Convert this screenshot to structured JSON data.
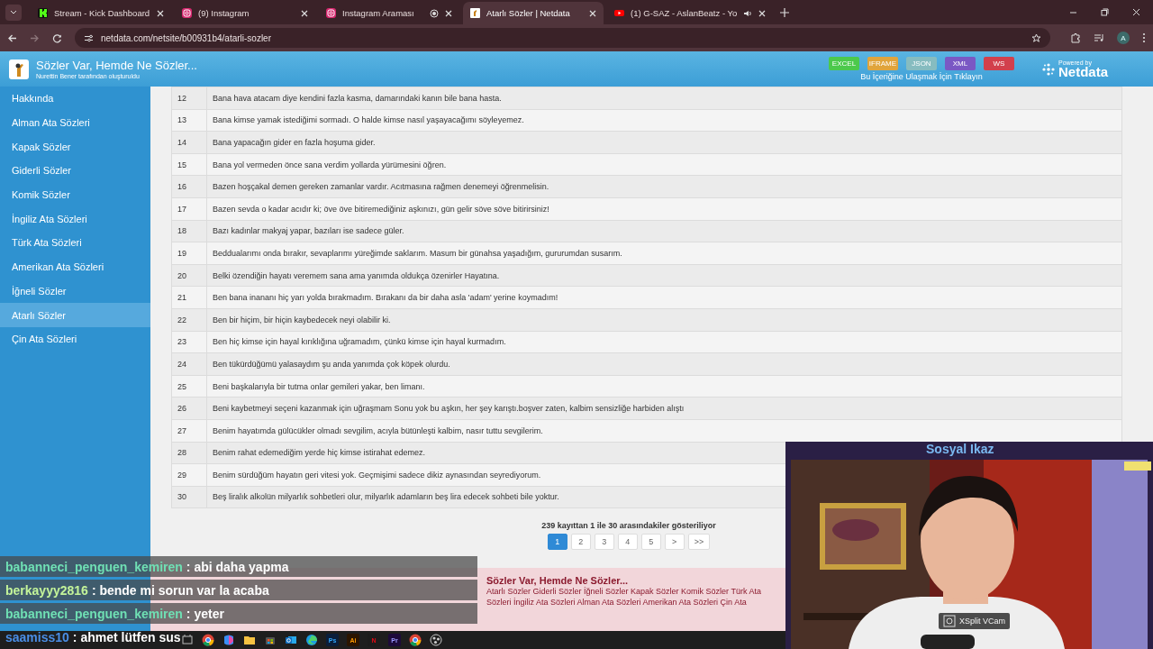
{
  "browser": {
    "tabs": [
      {
        "title": "Stream - Kick Dashboard",
        "kind": "kick",
        "selected": false,
        "recording": false,
        "audio": false
      },
      {
        "title": "(9) Instagram",
        "kind": "instagram",
        "selected": false,
        "recording": false,
        "audio": false
      },
      {
        "title": "Instagram Araması",
        "kind": "instagram",
        "selected": false,
        "recording": true,
        "audio": false
      },
      {
        "title": "Atarlı Sözler | Netdata",
        "kind": "site",
        "selected": true,
        "recording": false,
        "audio": false
      },
      {
        "title": "(1) G-SAZ - AslanBeatz - Yo",
        "kind": "youtube",
        "selected": false,
        "recording": false,
        "audio": true
      }
    ],
    "url": "netdata.com/netsite/b00931b4/atarli-sozler",
    "profile": "A"
  },
  "site_header": {
    "title": "Sözler Var, Hemde Ne Sözler...",
    "subtitle": "Nurettin Bener tarafından oluşturuldu",
    "exports": [
      {
        "label": "EXCEL",
        "color": "#4cc94c"
      },
      {
        "label": "IFRAME",
        "color": "#e0a43c"
      },
      {
        "label": "JSON",
        "color": "#86bcc0"
      },
      {
        "label": "XML",
        "color": "#7a58c4"
      },
      {
        "label": "WS",
        "color": "#d2404c"
      }
    ],
    "access_link": "Bu İçeriğine Ulaşmak İçin Tıklayın",
    "powered_by": "Powered by",
    "brand": "Netdata"
  },
  "sidebar": {
    "items": [
      {
        "label": "Hakkında",
        "selected": false
      },
      {
        "label": "Alman Ata Sözleri",
        "selected": false
      },
      {
        "label": "Kapak Sözler",
        "selected": false
      },
      {
        "label": "Giderli Sözler",
        "selected": false
      },
      {
        "label": "Komik Sözler",
        "selected": false
      },
      {
        "label": "İngiliz Ata Sözleri",
        "selected": false
      },
      {
        "label": "Türk Ata Sözleri",
        "selected": false
      },
      {
        "label": "Amerikan Ata Sözleri",
        "selected": false
      },
      {
        "label": "İğneli Sözler",
        "selected": false
      },
      {
        "label": "Atarlı Sözler",
        "selected": true
      },
      {
        "label": "Çin Ata Sözleri",
        "selected": false
      }
    ]
  },
  "table": {
    "rows": [
      {
        "number": "12",
        "text": "Bana hava atacam diye kendini fazla kasma, damarındaki kanın bile bana hasta."
      },
      {
        "number": "13",
        "text": "Bana kimse yamak istediğimi sormadı. O halde kimse nasıl yaşayacağımı söyleyemez."
      },
      {
        "number": "14",
        "text": "Bana yapacağın gider en fazla hoşuma gider."
      },
      {
        "number": "15",
        "text": "Bana yol vermeden önce sana verdim yollarda yürümesini öğren."
      },
      {
        "number": "16",
        "text": "Bazen hoşçakal demen gereken zamanlar vardır. Acıtmasına rağmen denemeyi öğrenmelisin."
      },
      {
        "number": "17",
        "text": "Bazen sevda o kadar acıdır ki; öve öve bitiremediğiniz aşkınızı, gün gelir söve söve bitirirsiniz!"
      },
      {
        "number": "18",
        "text": "Bazı kadınlar makyaj yapar, bazıları ise sadece güler."
      },
      {
        "number": "19",
        "text": "Beddualarımı onda bırakır, sevaplarımı yüreğimde saklarım. Masum bir günahsa yaşadığım, gururumdan susarım."
      },
      {
        "number": "20",
        "text": "Belki özendiğin hayatı veremem sana ama yanımda oldukça özenirler Hayatına."
      },
      {
        "number": "21",
        "text": "Ben bana inananı hiç yarı yolda bırakmadım. Bırakanı da bir daha asla 'adam' yerine koymadım!"
      },
      {
        "number": "22",
        "text": "Ben bir hiçim, bir hiçin kaybedecek neyi olabilir ki."
      },
      {
        "number": "23",
        "text": "Ben hiç kimse için hayal kırıklığına uğramadım, çünkü kimse için hayal kurmadım."
      },
      {
        "number": "24",
        "text": "Ben tükürdüğümü yalasaydım şu anda yanımda çok köpek olurdu."
      },
      {
        "number": "25",
        "text": "Beni başkalarıyla bir tutma onlar gemileri yakar, ben limanı."
      },
      {
        "number": "26",
        "text": "Beni kaybetmeyi seçeni kazanmak için uğraşmam Sonu yok bu aşkın, her şey karıştı.boşver zaten, kalbim sensizliğe harbiden alıştı"
      },
      {
        "number": "27",
        "text": "Benim hayatımda gülücükler olmadı sevgilim, acıyla bütünleşti kalbim, nasır tuttu sevgilerim."
      },
      {
        "number": "28",
        "text": "Benim rahat edemediğim yerde hiç kimse istirahat edemez."
      },
      {
        "number": "29",
        "text": "Benim sürdüğüm hayatın geri vitesi yok. Geçmişimi sadece dikiz aynasından seyrediyorum."
      },
      {
        "number": "30",
        "text": "Beş liralık alkolün milyarlık sohbetleri olur, milyarlık adamların beş lira edecek sohbeti bile yoktur."
      }
    ]
  },
  "pagination": {
    "summary": "239 kayıttan 1 ile 30 arasındakiler gösteriliyor",
    "pages": [
      {
        "label": "1",
        "selected": true
      },
      {
        "label": "2",
        "selected": false
      },
      {
        "label": "3",
        "selected": false
      },
      {
        "label": "4",
        "selected": false
      },
      {
        "label": "5",
        "selected": false
      },
      {
        "label": ">",
        "selected": false
      },
      {
        "label": ">>",
        "selected": false
      }
    ]
  },
  "footer": {
    "title": "Sözler Var, Hemde Ne Sözler...",
    "links": "Atarlı Sözler Giderli Sözler İğneli Sözler Kapak Sözler Komik Sözler Türk Ata Sözleri İngiliz Ata Sözleri Alman Ata Sözleri Amerikan Ata Sözleri Çin Ata"
  },
  "chat": [
    {
      "user": "babanneci_penguen_kemiren",
      "color": "#6fe0b4",
      "message": ": abi daha yapma"
    },
    {
      "user": "berkayyy2816",
      "color": "#c4f49a",
      "message": ": bende mi sorun var la acaba"
    },
    {
      "user": "babanneci_penguen_kemiren",
      "color": "#6fe0b4",
      "message": ": yeter"
    },
    {
      "user": "saamiss10",
      "color": "#4a8ee6",
      "message": ": ahmet lütfen sus"
    }
  ],
  "taskbar": [
    {
      "kind": "taskview"
    },
    {
      "kind": "chrome"
    },
    {
      "kind": "copilot"
    },
    {
      "kind": "folder"
    },
    {
      "kind": "store"
    },
    {
      "kind": "outlook"
    },
    {
      "kind": "edge"
    },
    {
      "kind": "letter",
      "label": "Ps"
    },
    {
      "kind": "letter",
      "label": "Ai"
    },
    {
      "kind": "letter",
      "label": "N"
    },
    {
      "kind": "letter",
      "label": "Pr"
    },
    {
      "kind": "chrome"
    },
    {
      "kind": "obs"
    }
  ],
  "webcam": {
    "title": "Sosyal Ikaz",
    "badge": "XSplit VCam",
    "kind": "picture"
  }
}
